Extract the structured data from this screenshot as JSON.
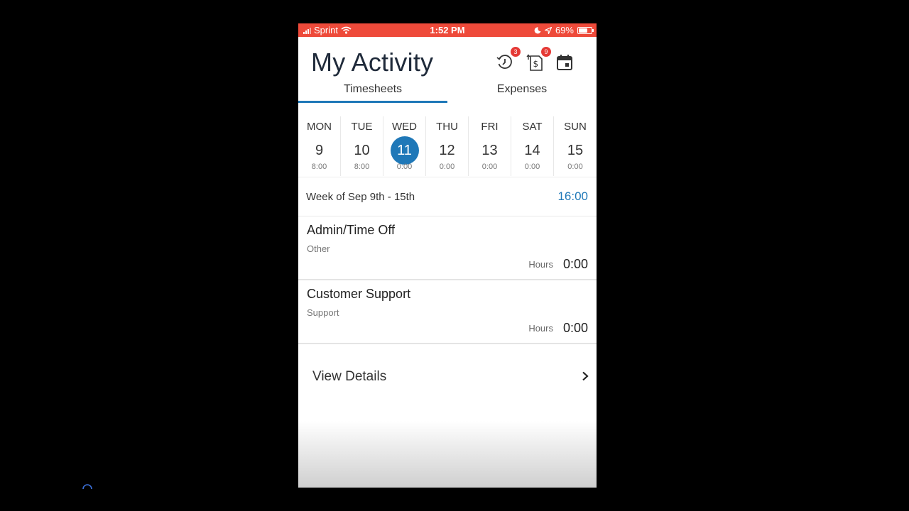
{
  "status_bar": {
    "carrier": "Sprint",
    "time": "1:52 PM",
    "battery": "69%",
    "battery_level": 0.69,
    "bar_color": "#ee4a3a",
    "icons": [
      "signal-icon",
      "wifi-icon",
      "moon-icon",
      "location-arrow-icon",
      "battery-icon"
    ]
  },
  "header": {
    "title": "My Activity",
    "icons": [
      {
        "name": "timesheet-history-icon",
        "badge": "3"
      },
      {
        "name": "expense-history-icon",
        "badge": "9"
      },
      {
        "name": "calendar-icon",
        "badge": ""
      }
    ]
  },
  "tabs": [
    {
      "label": "Timesheets",
      "active": true
    },
    {
      "label": "Expenses",
      "active": false
    }
  ],
  "days": [
    {
      "name": "MON",
      "num": "9",
      "hours": "8:00"
    },
    {
      "name": "TUE",
      "num": "10",
      "hours": "8:00"
    },
    {
      "name": "WED",
      "num": "11",
      "hours": "0:00",
      "selected": true
    },
    {
      "name": "THU",
      "num": "12",
      "hours": "0:00"
    },
    {
      "name": "FRI",
      "num": "13",
      "hours": "0:00"
    },
    {
      "name": "SAT",
      "num": "14",
      "hours": "0:00"
    },
    {
      "name": "SUN",
      "num": "15",
      "hours": "0:00"
    }
  ],
  "week": {
    "label": "Week of Sep 9th - 15th",
    "total": "16:00"
  },
  "activities": [
    {
      "name": "Admin/Time Off",
      "category": "Other",
      "hours_label": "Hours",
      "hours": "0:00"
    },
    {
      "name": "Customer Support",
      "category": "Support",
      "hours_label": "Hours",
      "hours": "0:00"
    }
  ],
  "view_details": {
    "label": "View Details"
  },
  "colors": {
    "accent": "#1f78b8",
    "badge": "#e53935"
  }
}
